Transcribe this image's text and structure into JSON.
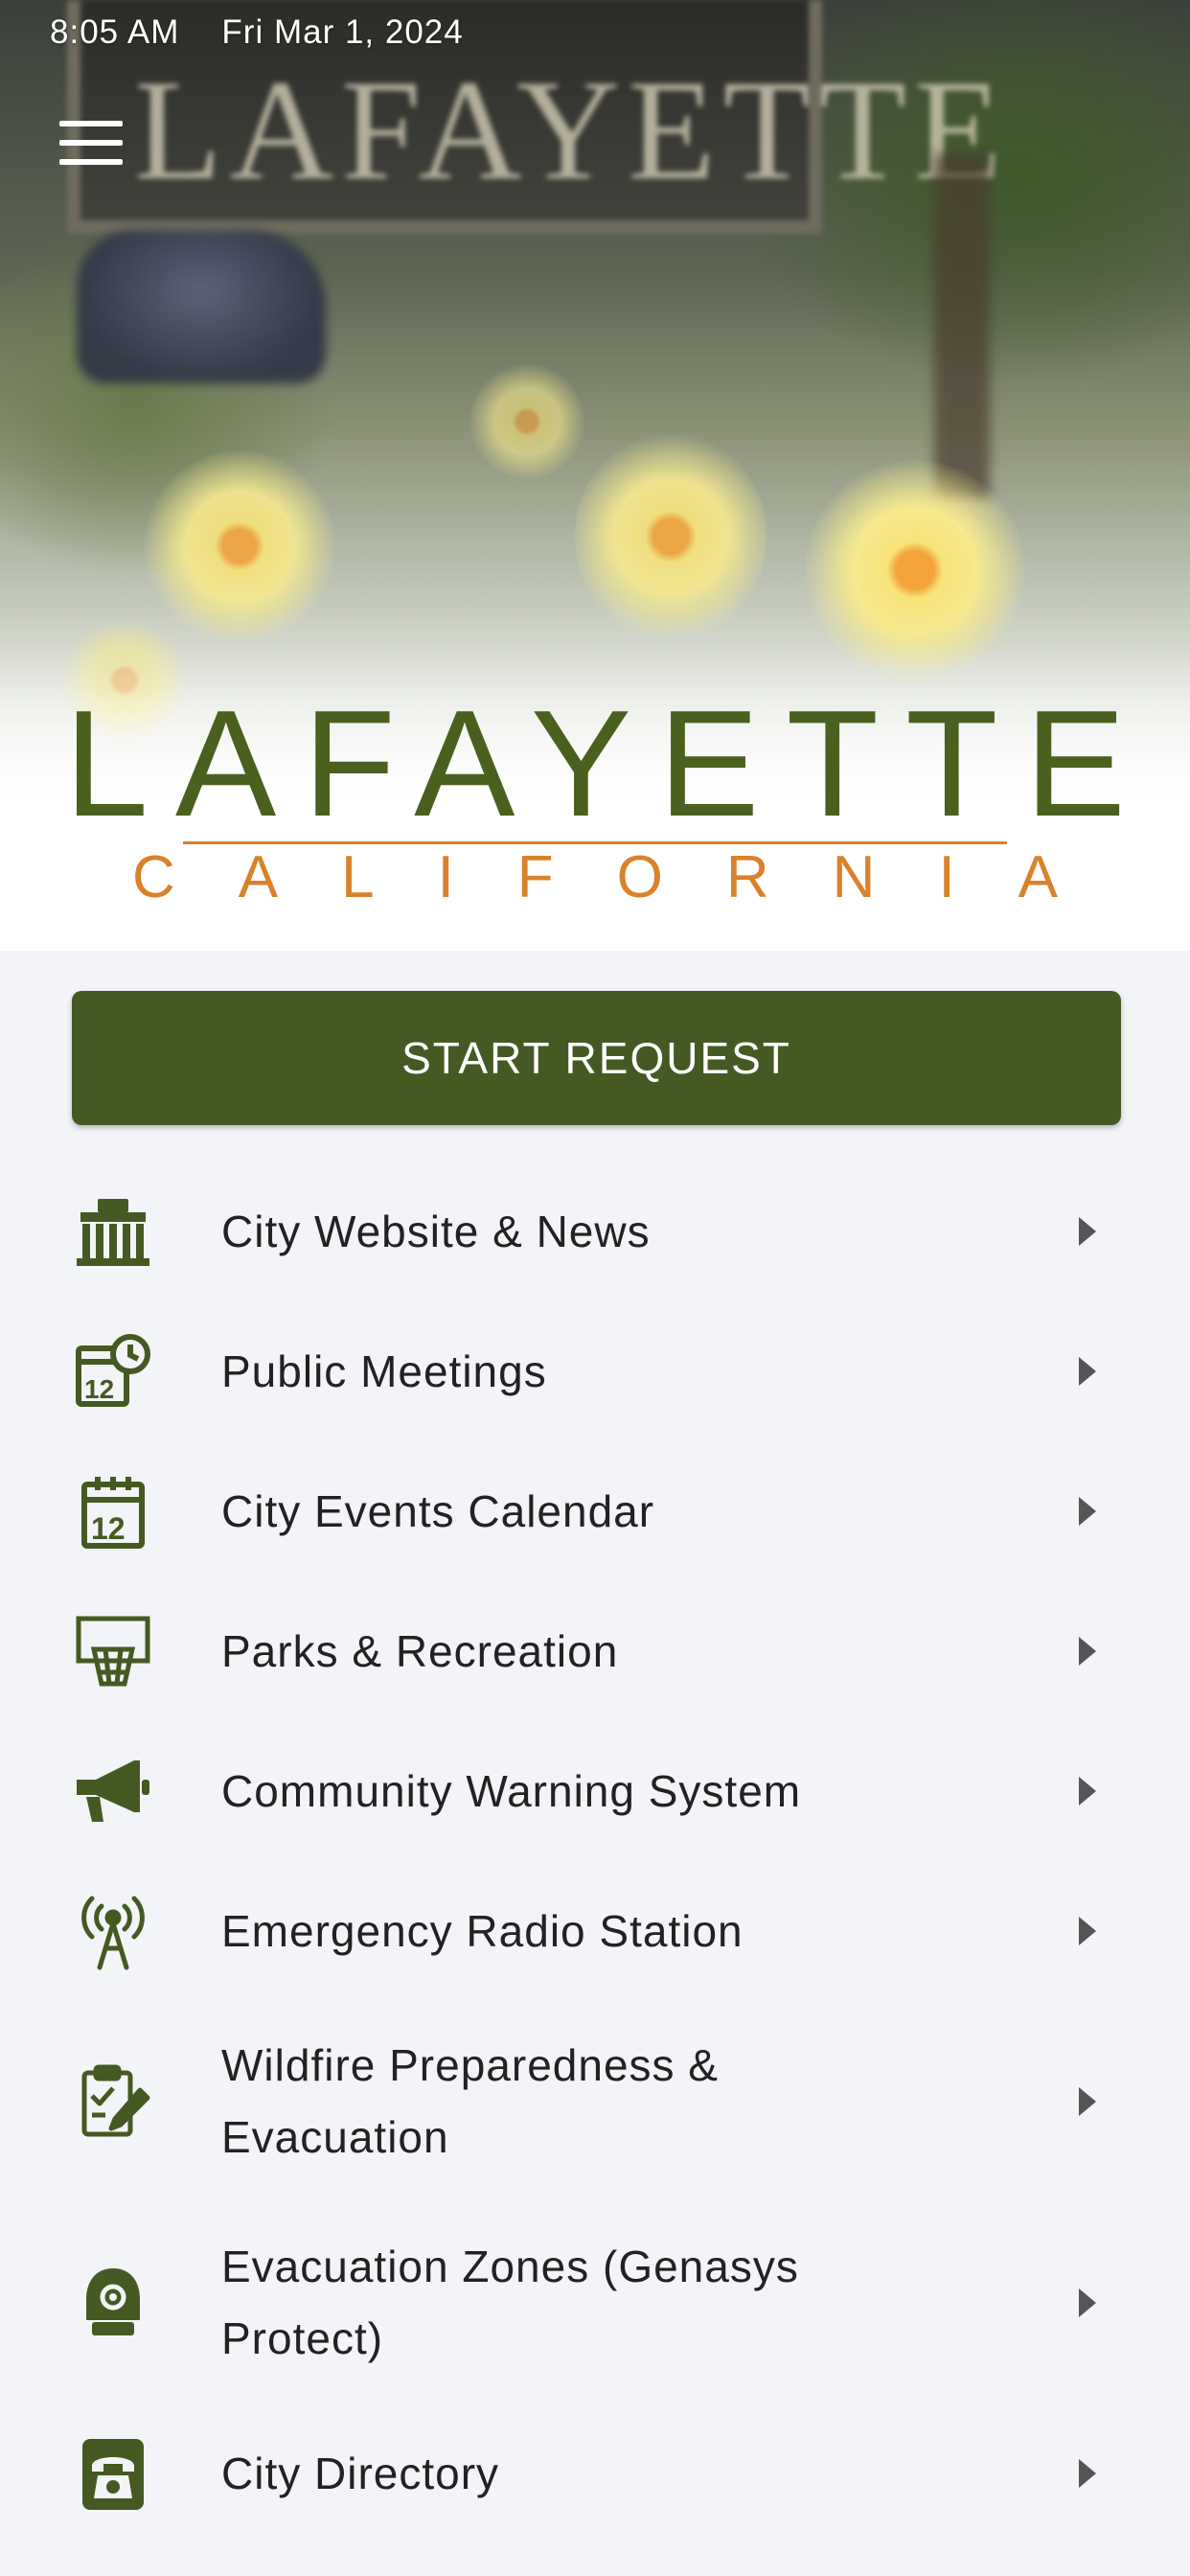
{
  "status_bar": {
    "time": "8:05 AM",
    "date": "Fri Mar 1, 2024"
  },
  "hero": {
    "sign_text": "LAFAYETTE",
    "logo_title": "LAFAYETTE",
    "logo_subtitle": "CALIFORNIA"
  },
  "start_request": {
    "label": "START REQUEST"
  },
  "menu_items": [
    {
      "label": "City Website & News",
      "icon": "city-hall-icon"
    },
    {
      "label": "Public Meetings",
      "icon": "calendar-clock-icon"
    },
    {
      "label": "City Events Calendar",
      "icon": "calendar-icon"
    },
    {
      "label": "Parks & Recreation",
      "icon": "basketball-hoop-icon"
    },
    {
      "label": "Community Warning System",
      "icon": "megaphone-icon"
    },
    {
      "label": "Emergency Radio Station",
      "icon": "radio-tower-icon"
    },
    {
      "label": "Wildfire Preparedness & Evacuation",
      "icon": "clipboard-edit-icon"
    },
    {
      "label": "Evacuation Zones (Genasys Protect)",
      "icon": "alarm-bell-icon"
    },
    {
      "label": "City Directory",
      "icon": "phone-icon"
    }
  ],
  "colors": {
    "accent_green": "#455a22",
    "logo_orange": "#d9822b",
    "logo_green": "#4a601f"
  }
}
